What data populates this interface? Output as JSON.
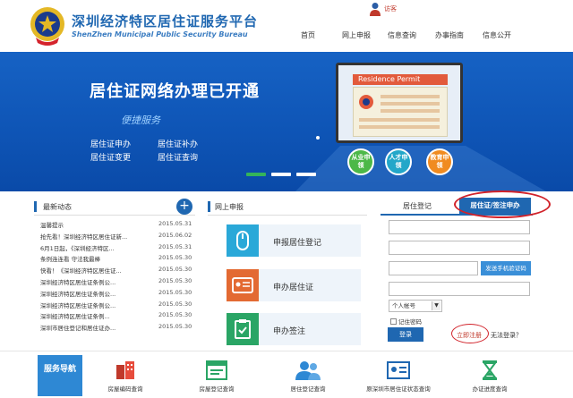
{
  "header": {
    "title_cn": "深圳经济特区居住证服务平台",
    "title_en": "ShenZhen Municipal Public Security Bureau",
    "visitor_label": "访客",
    "nav": [
      "首页",
      "网上申报",
      "信息查询",
      "办事指南",
      "信息公开"
    ]
  },
  "banner": {
    "title": "居住证网络办理已开通",
    "subtitle": "便捷服务",
    "links": [
      "居住证申办",
      "居住证补办",
      "居住证变更",
      "居住证查询"
    ],
    "screen_title": "Residence Permit",
    "badges": [
      "从业申领",
      "人才申领",
      "教育申领"
    ]
  },
  "news": {
    "title": "最新动态",
    "items": [
      {
        "text": "温馨提示",
        "date": "2015.05.31"
      },
      {
        "text": "抢先看！深圳经济特区居住证新...",
        "date": "2015.06.02"
      },
      {
        "text": "6月1日起，《深圳经济特区...",
        "date": "2015.05.31"
      },
      {
        "text": "条例连连看 守法我最棒",
        "date": "2015.05.30"
      },
      {
        "text": "快看！《深圳经济特区居住证...",
        "date": "2015.05.30"
      },
      {
        "text": "深圳经济特区居住证条例公...",
        "date": "2015.05.30"
      },
      {
        "text": "深圳经济特区居住证条例公...",
        "date": "2015.05.30"
      },
      {
        "text": "深圳经济特区居住证条例公...",
        "date": "2015.05.30"
      },
      {
        "text": "深圳经济特区居住证条例...",
        "date": "2015.05.30"
      },
      {
        "text": "深圳市居住登记和居住证办...",
        "date": "2015.05.30"
      }
    ]
  },
  "online": {
    "title": "网上申报",
    "services": [
      "申报居住登记",
      "申办居住证",
      "申办签注"
    ]
  },
  "login": {
    "tab_register": "居住登记",
    "tab_permit": "居住证/签注申办",
    "sms_button": "发送手机验证码",
    "account_type": "个人帐号",
    "remember": "记住密码",
    "login_button": "登录",
    "register": "立即注册",
    "cant_login": "无法登录？"
  },
  "bottom": {
    "nav_label": "服务导航",
    "items": [
      "房屋编码查询",
      "房屋登记查询",
      "居住登记查询",
      "原深圳市居住证状态查询",
      "办证进度查询"
    ]
  },
  "colors": {
    "brand_blue": "#1f67b1",
    "banner_blue": "#1662c4",
    "alert_red": "#d1222a",
    "green": "#34b45a"
  }
}
